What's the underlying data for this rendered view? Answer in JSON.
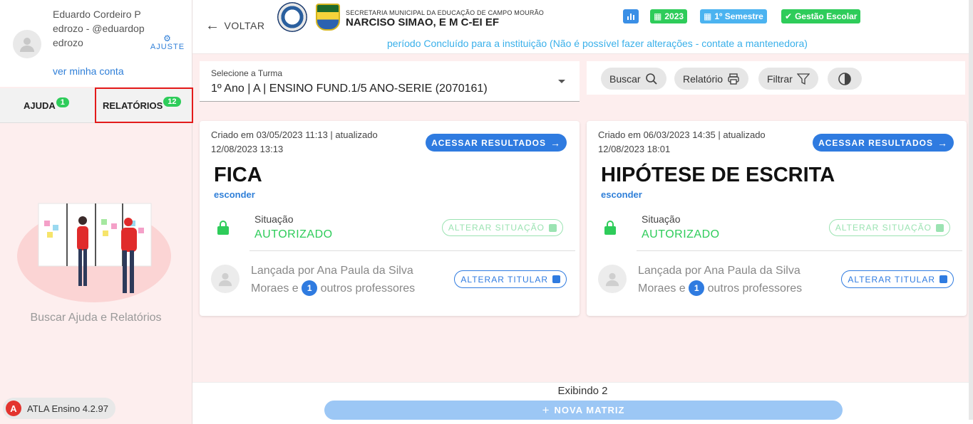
{
  "user": {
    "name": "Eduardo Cordeiro Pedrozo - @eduardopedrozo",
    "account_link": "ver minha conta",
    "settings_label": "AJUSTE"
  },
  "sidebar_tabs": {
    "help": {
      "label": "AJUDA",
      "count": "1"
    },
    "reports": {
      "label": "RELATÓRIOS",
      "count": "12"
    }
  },
  "sidebar": {
    "help_text": "Buscar Ajuda e Relatórios",
    "version": "ATLA Ensino 4.2.97",
    "version_logo": "A"
  },
  "header": {
    "back_label": "VOLTAR",
    "school_subtitle": "SECRETARIA MUNICIPAL DA EDUCAÇÃO DE CAMPO MOURÃO",
    "school_name": "NARCISO SIMAO, E M C-EI EF",
    "year": "2023",
    "semester": "1º Semestre",
    "management": "Gestão Escolar",
    "period_notice": "período Concluído para a instituição (Não é possível fazer alterações - contate a mantenedora)"
  },
  "turma": {
    "label": "Selecione a Turma",
    "value": "1º Ano | A | ENSINO FUND.1/5 ANO-SERIE (2070161)"
  },
  "toolbar": {
    "search": "Buscar",
    "report": "Relatório",
    "filter": "Filtrar"
  },
  "cards": [
    {
      "created": "Criado em 03/05/2023 11:13 | atualizado 12/08/2023 13:13",
      "access_label": "ACESSAR RESULTADOS",
      "title": "FICA",
      "hide_label": "esconder",
      "status_label": "Situação",
      "status_value": "AUTORIZADO",
      "alter_status_label": "ALTERAR SITUAÇÃO",
      "launched_prefix": "Lançada por Ana Paula da Silva Moraes e",
      "others_count": "1",
      "launched_suffix": "outros professores",
      "alter_owner_label": "ALTERAR TITULAR"
    },
    {
      "created": "Criado em 06/03/2023 14:35 | atualizado 12/08/2023 18:01",
      "access_label": "ACESSAR RESULTADOS",
      "title": "HIPÓTESE DE ESCRITA",
      "hide_label": "esconder",
      "status_label": "Situação",
      "status_value": "AUTORIZADO",
      "alter_status_label": "ALTERAR SITUAÇÃO",
      "launched_prefix": "Lançada por Ana Paula da Silva Moraes e",
      "others_count": "1",
      "launched_suffix": "outros professores",
      "alter_owner_label": "ALTERAR TITULAR"
    }
  ],
  "footer": {
    "showing": "Exibindo 2",
    "new_button": "NOVA MATRIZ"
  },
  "colors": {
    "accent_blue": "#2f7be0",
    "success_green": "#2ecc5a",
    "notice_blue": "#3ab0ea",
    "highlight_red": "#e31b1b"
  }
}
